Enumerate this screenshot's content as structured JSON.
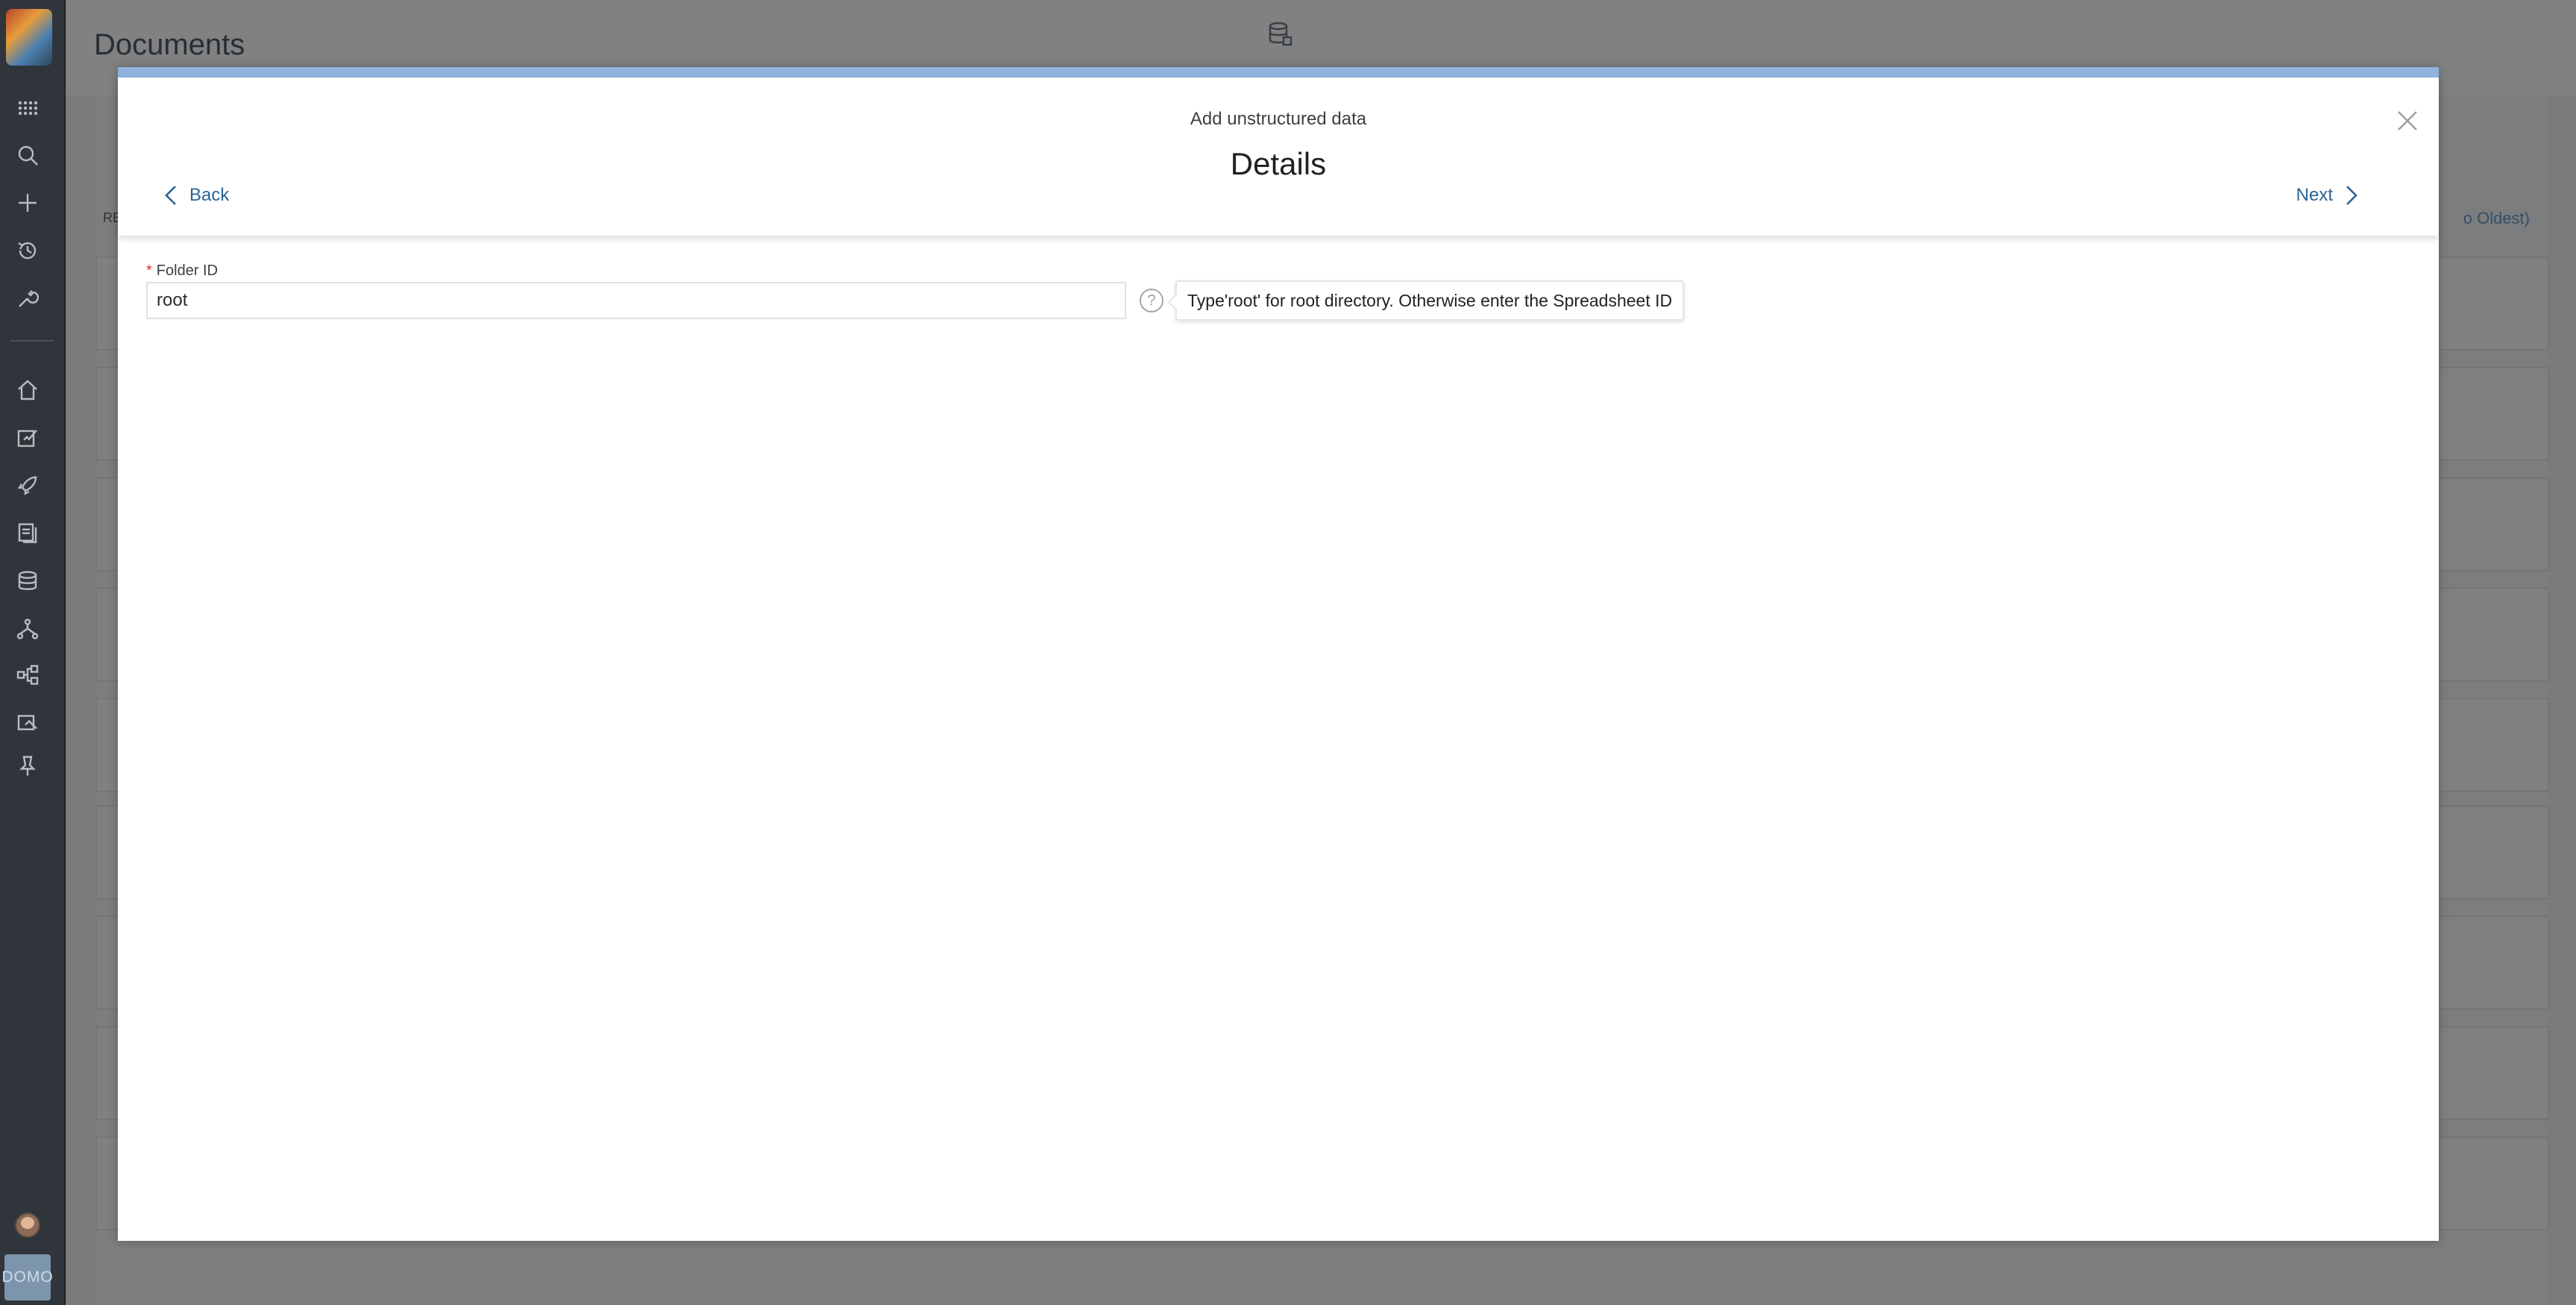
{
  "app": {
    "page_title": "Documents",
    "brand": "DOMO"
  },
  "sidebar": {
    "items": [
      {
        "icon": "apps-grid-icon"
      },
      {
        "icon": "search-icon"
      },
      {
        "icon": "plus-icon"
      },
      {
        "icon": "history-icon"
      },
      {
        "icon": "wrench-icon"
      },
      {
        "icon": "home-icon"
      },
      {
        "icon": "feed-icon"
      },
      {
        "icon": "rocket-icon"
      },
      {
        "icon": "pages-icon"
      },
      {
        "icon": "database-icon"
      },
      {
        "icon": "dataflow-icon"
      },
      {
        "icon": "org-chart-icon"
      },
      {
        "icon": "alerts-icon"
      },
      {
        "icon": "pin-icon"
      }
    ]
  },
  "background": {
    "sort_label": "o Oldest)",
    "list_label": "RE"
  },
  "modal": {
    "subtitle": "Add unstructured data",
    "title": "Details",
    "back_label": "Back",
    "next_label": "Next",
    "field": {
      "label": "Folder ID",
      "required_marker": "*",
      "value": "root",
      "help_symbol": "?",
      "tooltip": "Type'root' for root directory. Otherwise enter the Spreadsheet ID"
    }
  },
  "colors": {
    "accent_blue": "#2a6496",
    "modal_topbar": "#8fb3dc",
    "required_red": "#d9342b",
    "sidebar_bg": "#2f353b"
  }
}
